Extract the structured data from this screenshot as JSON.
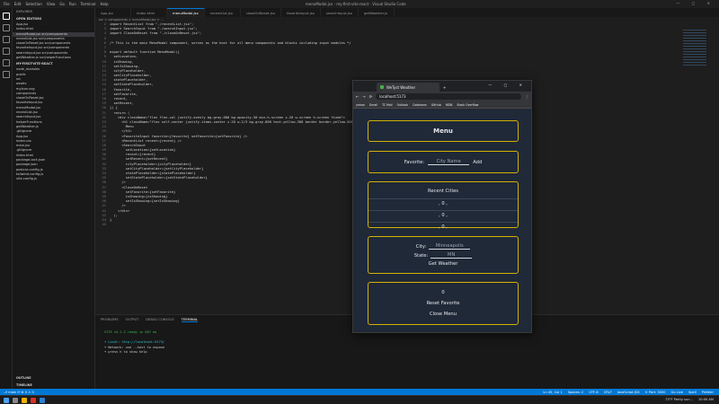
{
  "window": {
    "title": "menuModal.jsx - my-first-vite-react - Visual Studio Code",
    "menu": [
      "File",
      "Edit",
      "Selection",
      "View",
      "Go",
      "Run",
      "Terminal",
      "Help"
    ],
    "controls": "—  ▢  ✕"
  },
  "sidebar": {
    "header": "EXPLORER",
    "open_editors_title": "OPEN EDITORS",
    "open_editors": [
      "App.jsx",
      "index.html",
      "menuModal.jsx src\\components",
      "recentList.jsx src\\components",
      "closeOnReset.jsx src\\components",
      "favoriteInput.jsx src\\components",
      "searchInput.jsx src\\components",
      "getWeather.js src\\helperFunctions"
    ],
    "project_title": "MY-FIRST-VITE-REACT",
    "tree": [
      "node_modules",
      "public",
      "src",
      "assets",
      "myIcon.svg",
      "components",
      "closeOnReset.jsx",
      "favoriteInput.jsx",
      "menuModal.jsx",
      "recentList.jsx",
      "searchInput.jsx",
      "helperFunctions",
      "getWeather.js",
      ".gitignore",
      "App.jsx",
      "index.css",
      "main.jsx",
      ".gitignore",
      "index.html",
      "package-lock.json",
      "package.json",
      "postcss.config.js",
      "tailwind.config.js",
      "vite.config.js"
    ],
    "outline": "OUTLINE",
    "timeline": "TIMELINE"
  },
  "tabs": [
    {
      "label": "App.jsx",
      "active": false
    },
    {
      "label": "index.html",
      "active": false
    },
    {
      "label": "menuModal.jsx",
      "active": true
    },
    {
      "label": "recentList.jsx",
      "active": false
    },
    {
      "label": "closeOnReset.jsx",
      "active": false
    },
    {
      "label": "favoriteInput.jsx",
      "active": false
    },
    {
      "label": "searchInput.jsx",
      "active": false
    },
    {
      "label": "getWeather.js",
      "active": false
    }
  ],
  "breadcrumb": "src > components > menuModal.jsx > ...",
  "code_lines": [
    "import RecentList from \"./recentList.jsx\";",
    "import SearchInput from \"./searchInput.jsx\";",
    "import CloseOnReset from \"./closeOnReset.jsx\";",
    "",
    "/* This is the main MenuModal component, serves as the host for all menu components and blocks including input modules */",
    "",
    "export default function MenuModal({",
    "  setLocation,",
    "  isShowing,",
    "  setIsShowing,",
    "  cityPlaceholder,",
    "  setCityPlaceholder,",
    "  statePlaceholder,",
    "  setStatePlaceholder,",
    "  favorite,",
    "  setFavorite,",
    "  recent,",
    "  setRecent,",
    "}) {",
    "  return (",
    "    <div className=\"flex flex-col justify-evenly bg-gray-800 bg-opacity-50 min-h-screen z-20 w-screen h-screen fixed\">",
    "      <h1 className=\"flex self-center justify-items-center z-20 w-2/3 bg-gray-800 text-yellow-300 border border-yellow-500\">",
    "        Menu",
    "      </h1>",
    "      <FavoriteInput favorite={favorite} setFavorite={setFavorite} />",
    "      <RecentList recent={recent} />",
    "      <SearchInput",
    "        setLocation={setLocation}",
    "        recent={recent}",
    "        setRecent={setRecent}",
    "        cityPlaceholder={cityPlaceholder}",
    "        setCityPlaceholder={setCityPlaceholder}",
    "        statePlaceholder={statePlaceholder}",
    "        setStatePlaceholder={setStatePlaceholder}",
    "      />",
    "      <CloseOnReset",
    "        setFavorite={setFavorite}",
    "        isShowing={isShowing}",
    "        setIsShowing={setIsShowing}",
    "      />",
    "    </div>",
    "  );",
    "}",
    ""
  ],
  "code_start_line": 2,
  "panel": {
    "tabs": [
      "PROBLEMS",
      "OUTPUT",
      "DEBUG CONSOLE",
      "TERMINAL"
    ],
    "active": "TERMINAL",
    "terminal": [
      "VITE v4.1.2  ready in 607 ms",
      "",
      "➜  Local:   http://localhost:5173/",
      "➜  Network: use --host to expose",
      "➜  press h to show help"
    ]
  },
  "statusbar": {
    "left": "⎇ main  ⟳  ⊗ 0  ⚠ 0",
    "right": [
      "Ln 45, Col 1",
      "Spaces: 2",
      "UTF-8",
      "CRLF",
      "JavaScript JSX",
      "⊙ Port: 3000",
      "Go Live",
      "Spell",
      "Prettier"
    ]
  },
  "taskbar": {
    "weather": "73°F Partly sun...",
    "time": "10:00 AM"
  },
  "browser": {
    "tab_title": "WeTyst Weather",
    "url": "localhost:5173",
    "bookmarks": [
      "yahoo",
      "Gmail",
      "TC Mail",
      "Outlook",
      "Codewars",
      "GitHub",
      "MDN",
      "Stack Overflow"
    ],
    "controls": "—  ▢  ✕",
    "app": {
      "title": "Menu",
      "favorite_label": "Favorite:",
      "favorite_placeholder": "City Name",
      "favorite_add": "Add",
      "recent_title": "Recent Cities",
      "recent_items": [
        ", 0 ,",
        ", 0 ,",
        ", 0 ,"
      ],
      "city_label": "City:",
      "city_value": "Minneapolis",
      "state_label": "State:",
      "state_value": "MN",
      "get_weather": "Get Weather",
      "counter": "0",
      "reset_favorite": "Reset Favorite",
      "close_menu": "Close Menu"
    }
  }
}
